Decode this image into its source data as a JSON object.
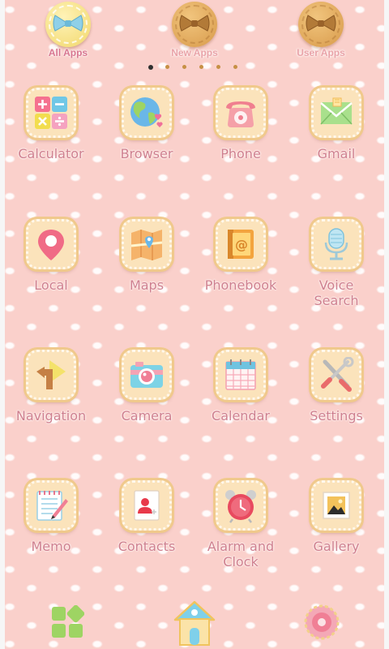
{
  "tabs": [
    {
      "label": "All Apps",
      "active": true
    },
    {
      "label": "New Apps",
      "active": false
    },
    {
      "label": "User Apps",
      "active": false
    }
  ],
  "page_indicator": {
    "count": 6,
    "current": 1
  },
  "apps": [
    {
      "label": "Calculator",
      "icon": "calculator-icon"
    },
    {
      "label": "Browser",
      "icon": "globe-icon"
    },
    {
      "label": "Phone",
      "icon": "telephone-icon"
    },
    {
      "label": "Gmail",
      "icon": "mail-envelope-icon"
    },
    {
      "label": "Local",
      "icon": "map-pin-icon"
    },
    {
      "label": "Maps",
      "icon": "map-icon"
    },
    {
      "label": "Phonebook",
      "icon": "address-book-icon"
    },
    {
      "label": "Voice\nSearch",
      "icon": "microphone-icon"
    },
    {
      "label": "Navigation",
      "icon": "direction-arrow-icon"
    },
    {
      "label": "Camera",
      "icon": "camera-icon"
    },
    {
      "label": "Calendar",
      "icon": "calendar-icon"
    },
    {
      "label": "Settings",
      "icon": "tools-icon"
    },
    {
      "label": "Memo",
      "icon": "notepad-pencil-icon"
    },
    {
      "label": "Contacts",
      "icon": "contact-card-icon"
    },
    {
      "label": "Alarm and\nClock",
      "icon": "alarm-clock-icon"
    },
    {
      "label": "Gallery",
      "icon": "picture-frame-icon"
    }
  ],
  "dock": [
    {
      "icon": "app-grid-icon"
    },
    {
      "icon": "house-icon"
    },
    {
      "icon": "flower-donut-icon"
    }
  ],
  "colors": {
    "background": "#fad0cb",
    "label": "#cf7f8e",
    "cookie": "#e6ad5e"
  }
}
